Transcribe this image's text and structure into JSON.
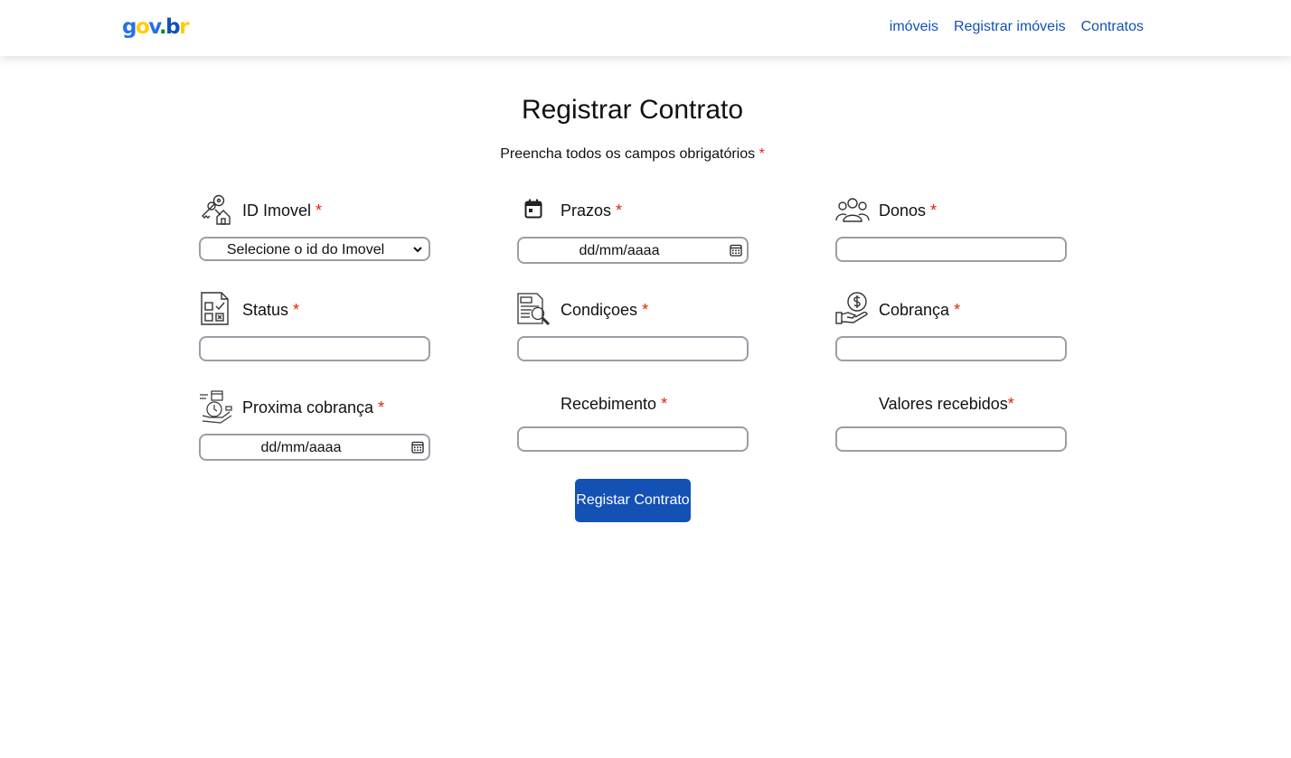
{
  "nav": {
    "logo": "gov.br",
    "links": [
      "imóveis",
      "Registrar imóveis",
      "Contratos"
    ]
  },
  "page": {
    "title": "Registrar Contrato",
    "subtitle": "Preencha todos os campos obrigatórios",
    "required_mark": "*"
  },
  "fields": {
    "id_imovel": {
      "label": "ID Imovel",
      "placeholder": "Selecione o id do Imovel",
      "icon": "keys-house-icon"
    },
    "prazos": {
      "label": "Prazos",
      "placeholder": "dd/mm/aaaa",
      "icon": "calendar-icon"
    },
    "donos": {
      "label": "Donos",
      "value": "",
      "icon": "group-people-icon"
    },
    "status": {
      "label": "Status",
      "value": "",
      "icon": "checklist-icon"
    },
    "condicoes": {
      "label": "Condiçoes",
      "value": "",
      "icon": "document-magnifier-icon"
    },
    "cobranca": {
      "label": "Cobrança",
      "value": "",
      "icon": "hand-coin-icon"
    },
    "proxima_cobranca": {
      "label": "Proxima cobrança",
      "placeholder": "dd/mm/aaaa",
      "icon": "payment-schedule-icon"
    },
    "recebimento": {
      "label": "Recebimento",
      "value": ""
    },
    "valores_recebidos": {
      "label": "Valores recebidos",
      "value": ""
    }
  },
  "submit_label": "Registar Contrato",
  "colors": {
    "primary": "#1351b4",
    "required": "#e52207",
    "input_border": "#9a9ea6"
  }
}
